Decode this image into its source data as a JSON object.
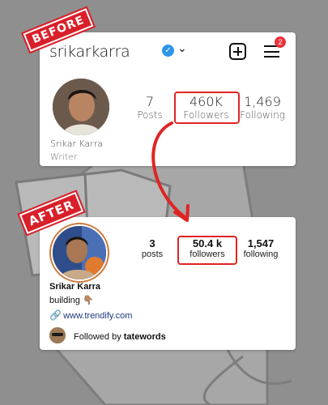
{
  "before": {
    "stamp": "BEFORE",
    "username": "srikarkarra",
    "notification_count": "2",
    "stats": [
      {
        "value": "7",
        "label": "Posts"
      },
      {
        "value": "460K",
        "label": "Followers"
      },
      {
        "value": "1,469",
        "label": "Following"
      }
    ],
    "name": "Srikar Karra",
    "role": "Writer"
  },
  "after": {
    "stamp": "AFTER",
    "stats": [
      {
        "value": "3",
        "label": "posts"
      },
      {
        "value": "50.4 k",
        "label": "followers"
      },
      {
        "value": "1,547",
        "label": "following"
      }
    ],
    "name": "Srikar Karra",
    "bio": "building 👇🏽",
    "link": "www.trendify.com",
    "followed_by_prefix": "Followed by",
    "followed_by_user": "tatewords"
  },
  "colors": {
    "highlight": "#e02424",
    "verified": "#2f95e9",
    "background": "#8f8f8f"
  },
  "icons": [
    "verified-badge-icon",
    "chevron-down-icon",
    "plus-square-icon",
    "hamburger-menu-icon",
    "link-icon"
  ]
}
